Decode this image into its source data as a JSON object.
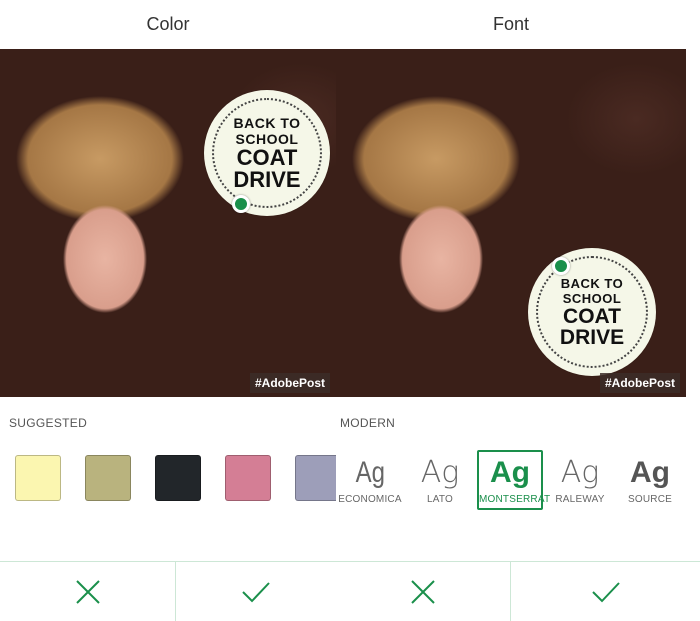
{
  "left": {
    "title": "Color",
    "badge": {
      "line1": "BACK TO",
      "line2": "SCHOOL",
      "line3": "COAT",
      "line4": "DRIVE"
    },
    "hashtag": "#AdobePost",
    "section_label": "SUGGESTED",
    "swatches": [
      {
        "name": "pale-yellow",
        "color": "#fbf6b0"
      },
      {
        "name": "olive",
        "color": "#b9b37e"
      },
      {
        "name": "black",
        "color": "#22262a"
      },
      {
        "name": "rose",
        "color": "#d47e95"
      },
      {
        "name": "lavender",
        "color": "#9d9eb9"
      }
    ]
  },
  "right": {
    "title": "Font",
    "badge": {
      "line1": "BACK TO",
      "line2": "SCHOOL",
      "line3": "COAT",
      "line4": "DRIVE"
    },
    "hashtag": "#AdobePost",
    "section_label": "MODERN",
    "fonts": [
      {
        "sample": "Ag",
        "name": "ECONOMICA"
      },
      {
        "sample": "Ag",
        "name": "LATO"
      },
      {
        "sample": "Ag",
        "name": "MONTSERRAT",
        "selected": true
      },
      {
        "sample": "Ag",
        "name": "RALEWAY"
      },
      {
        "sample": "Ag",
        "name": "SOURCE"
      }
    ]
  },
  "actions": {
    "cancel_icon": "close-icon",
    "confirm_icon": "check-icon",
    "accent": "#1a8f4b"
  }
}
